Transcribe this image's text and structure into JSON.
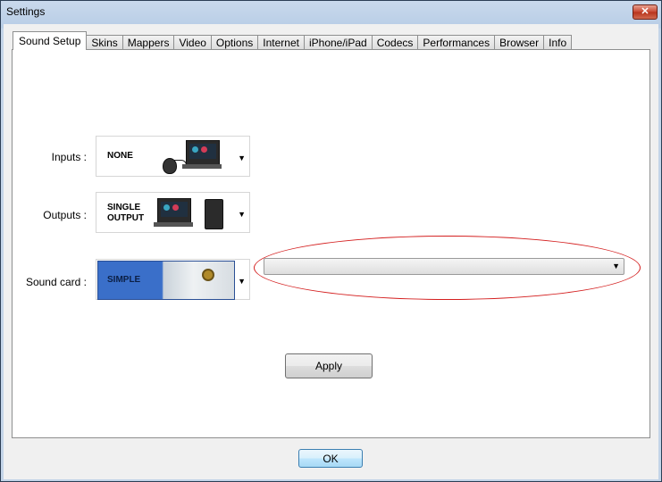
{
  "window": {
    "title": "Settings",
    "close_label": "✕"
  },
  "tabs": [
    "Sound Setup",
    "Skins",
    "Mappers",
    "Video",
    "Options",
    "Internet",
    "iPhone/iPad",
    "Codecs",
    "Performances",
    "Browser",
    "Info"
  ],
  "active_tab": "Sound Setup",
  "sound_setup": {
    "inputs": {
      "label": "Inputs :",
      "value": "NONE"
    },
    "outputs": {
      "label": "Outputs :",
      "value_line1": "SINGLE",
      "value_line2": "OUTPUT"
    },
    "sound_card": {
      "label": "Sound card :",
      "value": "SIMPLE",
      "device_value": ""
    },
    "apply_label": "Apply"
  },
  "ok_label": "OK",
  "colors": {
    "highlight": "#d42020",
    "sound_card_blue": "#3a6fc9"
  }
}
